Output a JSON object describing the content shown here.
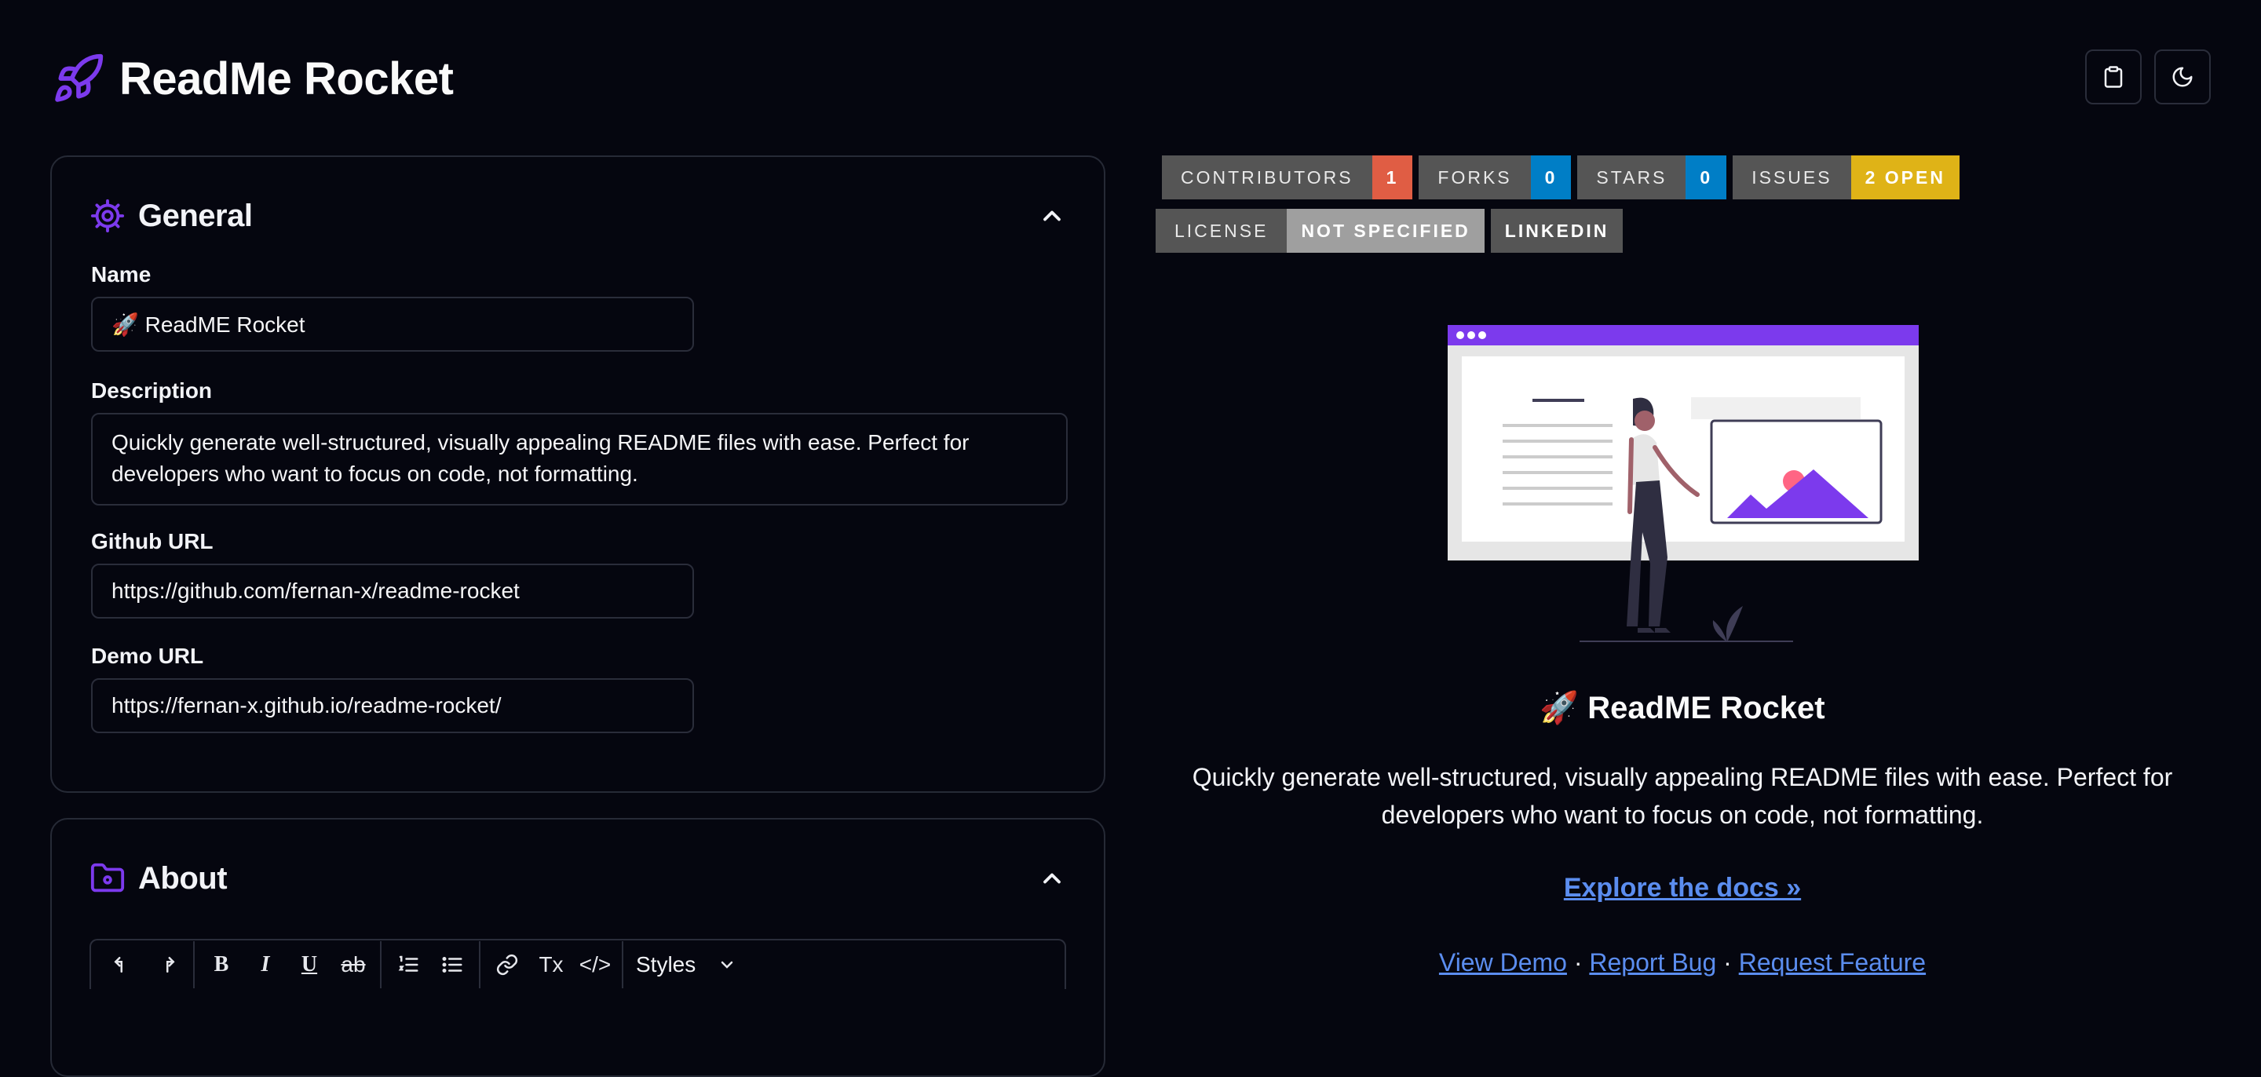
{
  "app": {
    "title": "ReadMe Rocket"
  },
  "toolbar_top": {
    "clipboard_icon": "clipboard-icon",
    "theme_icon": "moon-icon"
  },
  "general": {
    "title": "General",
    "name_label": "Name",
    "name_value": "🚀 ReadME Rocket",
    "description_label": "Description",
    "description_value": "Quickly generate well-structured, visually appealing README files with ease. Perfect for developers who want to focus on code, not formatting.",
    "github_label": "Github URL",
    "github_value": "https://github.com/fernan-x/readme-rocket",
    "demo_label": "Demo URL",
    "demo_value": "https://fernan-x.github.io/readme-rocket/"
  },
  "about": {
    "title": "About",
    "editor": {
      "styles_label": "Styles",
      "strike_label": "ab",
      "clear_label": "Tx",
      "code_label": "</>"
    }
  },
  "badges": {
    "row1": [
      {
        "label": "CONTRIBUTORS",
        "value": "1",
        "color": "#e05d44"
      },
      {
        "label": "FORKS",
        "value": "0",
        "color": "#007ec6"
      },
      {
        "label": "STARS",
        "value": "0",
        "color": "#007ec6"
      },
      {
        "label": "ISSUES",
        "value": "2 OPEN",
        "color": "#dfb317"
      }
    ],
    "row2": [
      {
        "label": "LICENSE",
        "value": "NOT SPECIFIED",
        "color": "#9f9f9f"
      },
      {
        "label": "",
        "value": "LINKEDIN",
        "color": "#555555"
      }
    ]
  },
  "preview": {
    "title": "🚀 ReadME Rocket",
    "description": "Quickly generate well-structured, visually appealing README files with ease. Perfect for developers who want to focus on code, not formatting.",
    "explore": "Explore the docs »",
    "view_demo": "View Demo",
    "report_bug": "Report Bug",
    "request_feature": "Request Feature",
    "separator": " · "
  },
  "colors": {
    "accent": "#7c3aed",
    "link": "#5b8def",
    "background": "#05060f",
    "border": "#262a36"
  }
}
